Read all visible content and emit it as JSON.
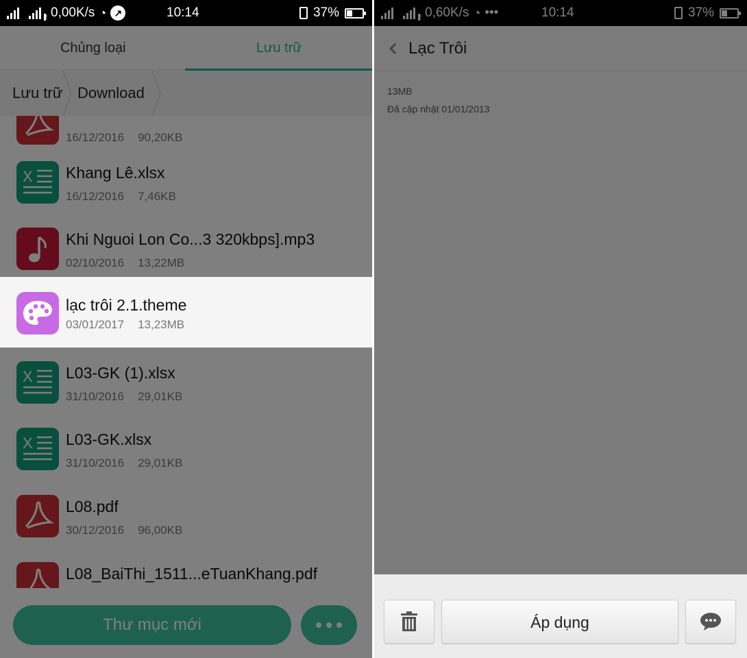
{
  "left": {
    "status": {
      "network_speed": "0,00K/s",
      "time": "10:14",
      "battery": "37%",
      "battery_level": 0.37,
      "sim2_label": "2"
    },
    "tabs": [
      {
        "label": "Chủng loại",
        "active": false
      },
      {
        "label": "Lưu trữ",
        "active": true
      }
    ],
    "breadcrumb": [
      "Lưu trữ",
      "Download"
    ],
    "files": [
      {
        "name": "",
        "date": "16/12/2016",
        "size": "90,20KB",
        "icon": "pdf-icon",
        "color": "#cc2f36"
      },
      {
        "name": "Khang Lê.xlsx",
        "date": "16/12/2016",
        "size": "7,46KB",
        "icon": "excel-icon",
        "color": "#139f7a"
      },
      {
        "name": "Khi Nguoi Lon Co...3 320kbps].mp3",
        "date": "02/10/2016",
        "size": "13,22MB",
        "icon": "music-icon",
        "color": "#c8173b"
      },
      {
        "name": "lạc trôi 2.1.theme",
        "date": "03/01/2017",
        "size": "13,23MB",
        "icon": "palette-icon",
        "color": "#c86ae6"
      },
      {
        "name": "L03-GK (1).xlsx",
        "date": "31/10/2016",
        "size": "29,01KB",
        "icon": "excel-icon",
        "color": "#139f7a"
      },
      {
        "name": "L03-GK.xlsx",
        "date": "31/10/2016",
        "size": "29,01KB",
        "icon": "excel-icon",
        "color": "#139f7a"
      },
      {
        "name": "L08.pdf",
        "date": "30/12/2016",
        "size": "96,00KB",
        "icon": "pdf-icon",
        "color": "#cc2f36"
      },
      {
        "name": "L08_BaiThi_1511...eTuanKhang.pdf",
        "date": "",
        "size": "",
        "icon": "pdf-icon",
        "color": "#cc2f36"
      }
    ],
    "new_folder_label": "Thư mục mới",
    "more_icon": "more-dots-icon",
    "accent": "#3cc29f"
  },
  "right": {
    "status": {
      "network_speed": "0,60K/s",
      "time": "10:14",
      "battery": "37%",
      "battery_level": 0.37,
      "sim2_label": "2"
    },
    "title": "Lạc Trôi",
    "size": "13MB",
    "updated": "Đã cập nhật 01/01/2013",
    "apply_label": "Áp dụng",
    "delete_icon": "trash-icon",
    "comment_icon": "comment-icon"
  }
}
